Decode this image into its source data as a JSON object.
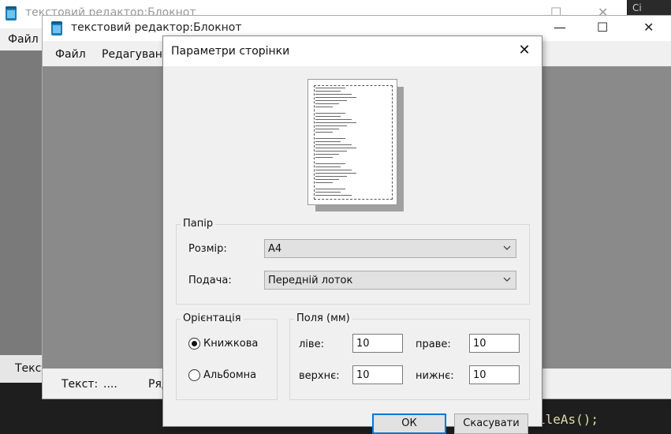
{
  "background": {
    "code_fragment": "ileAs();",
    "corner_text": "Ci"
  },
  "window_back": {
    "title": "текстовий редактор:Блокнот",
    "menu_file": "Файл",
    "status_text": "Текст"
  },
  "window_front": {
    "title": "текстовий редактор:Блокнот",
    "menu": [
      "Файл",
      "Редагування"
    ],
    "status_text_label": "Текст:",
    "status_text_value": "....",
    "status_row_label": "Ряд"
  },
  "dialog": {
    "title": "Параметри сторінки",
    "paper": {
      "group_label": "Папір",
      "size_label": "Розмір:",
      "size_value": "A4",
      "source_label": "Подача:",
      "source_value": "Передній лоток"
    },
    "orientation": {
      "group_label": "Орієнтація",
      "portrait_label": "Книжкова",
      "landscape_label": "Альбомна",
      "selected": "portrait"
    },
    "margins": {
      "group_label": "Поля (мм)",
      "left_label": "ліве:",
      "left_value": "10",
      "right_label": "праве:",
      "right_value": "10",
      "top_label": "верхнє:",
      "top_value": "10",
      "bottom_label": "нижнє:",
      "bottom_value": "10"
    },
    "ok_label": "ОК",
    "cancel_label": "Скасувати"
  },
  "colors": {
    "accent": "#0078d7",
    "dark_bg": "#1e1e1e"
  }
}
